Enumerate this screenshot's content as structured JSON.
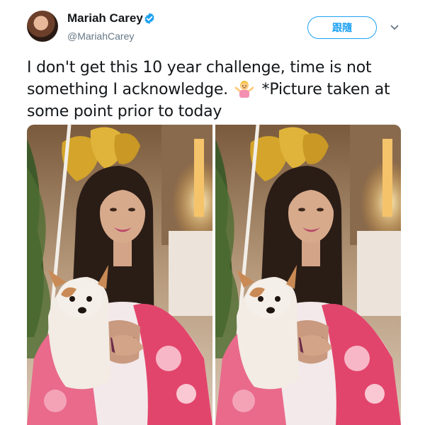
{
  "user": {
    "display_name": "Mariah Carey",
    "handle": "@MariahCarey",
    "verified": true
  },
  "follow_button": {
    "label": "跟隨"
  },
  "tweet": {
    "text_before_emoji": "I don't get this 10 year challenge, time is not something I acknowledge.",
    "emoji": "woman-shrugging-emoji",
    "text_after_emoji": "*Picture taken at some point prior to today"
  },
  "media": {
    "photo_count": 2
  },
  "colors": {
    "accent": "#1da1f2",
    "text": "#14171a",
    "secondary_text": "#657786"
  },
  "icons": {
    "verified": "verified-badge-icon",
    "caret": "chevron-down-icon"
  }
}
